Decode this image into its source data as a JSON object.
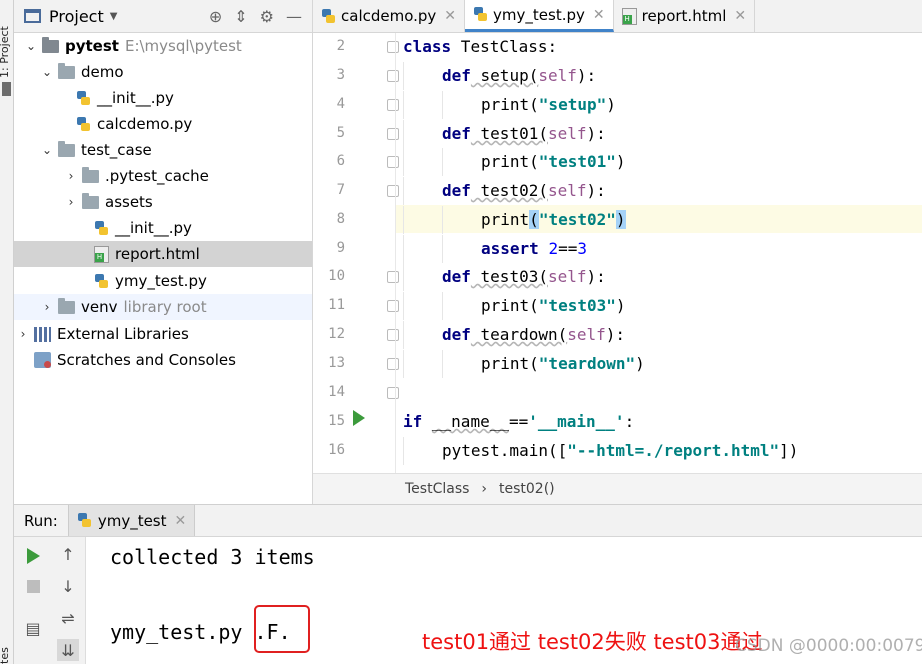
{
  "left_strip": {
    "project_label": "1: Project",
    "bottom_label": "tes"
  },
  "project_panel": {
    "title": "Project",
    "tree": [
      {
        "label": "pytest",
        "note": "E:\\mysql\\pytest"
      },
      {
        "label": "demo"
      },
      {
        "label": "__init__.py"
      },
      {
        "label": "calcdemo.py"
      },
      {
        "label": "test_case"
      },
      {
        "label": ".pytest_cache"
      },
      {
        "label": "assets"
      },
      {
        "label": "__init__.py"
      },
      {
        "label": "report.html"
      },
      {
        "label": "ymy_test.py"
      },
      {
        "label": "venv",
        "note": "library root"
      },
      {
        "label": "External Libraries"
      },
      {
        "label": "Scratches and Consoles"
      }
    ]
  },
  "editor": {
    "tabs": [
      {
        "label": "calcdemo.py"
      },
      {
        "label": "ymy_test.py"
      },
      {
        "label": "report.html"
      }
    ],
    "line_numbers": [
      "2",
      "3",
      "4",
      "5",
      "6",
      "7",
      "8",
      "9",
      "10",
      "11",
      "12",
      "13",
      "14",
      "15",
      "16"
    ],
    "code": {
      "l2_kw": "class",
      "l2_rest": " TestClass:",
      "l3_kw": "def",
      "l3_name": " setup(",
      "l3_self": "self",
      "l3_end": "):",
      "l4_fn": "print(",
      "l4_str": "\"setup\"",
      "l4_end": ")",
      "l5_kw": "def",
      "l5_name": " test01(",
      "l5_self": "self",
      "l5_end": "):",
      "l6_fn": "print(",
      "l6_str": "\"test01\"",
      "l6_end": ")",
      "l7_kw": "def",
      "l7_name": " test02(",
      "l7_self": "self",
      "l7_end": "):",
      "l8_fn": "print",
      "l8_open": "(",
      "l8_str": "\"test02\"",
      "l8_close": ")",
      "l9_kw": "assert",
      "l9_sp": " ",
      "l9_num1": "2",
      "l9_op": "==",
      "l9_num2": "3",
      "l10_kw": "def",
      "l10_name": " test03(",
      "l10_self": "self",
      "l10_end": "):",
      "l11_fn": "print(",
      "l11_str": "\"test03\"",
      "l11_end": ")",
      "l12_kw": "def",
      "l12_name": " teardown(",
      "l12_self": "self",
      "l12_end": "):",
      "l13_fn": "print(",
      "l13_str": "\"teardown\"",
      "l13_end": ")",
      "l15_kw": "if",
      "l15_sp": " ",
      "l15_name": "__name__",
      "l15_op": "==",
      "l15_str": "'__main__'",
      "l15_end": ":",
      "l16_fn": "pytest.main([",
      "l16_str": "\"--html=./report.html\"",
      "l16_end": "])"
    },
    "breadcrumb": {
      "class": "TestClass",
      "sep": "›",
      "method": "test02()"
    }
  },
  "run_panel": {
    "label": "Run:",
    "tab": "ymy_test",
    "console_line1": "collected 3 items",
    "console_line2_file": "ymy_test.py ",
    "console_line2_result": ".F."
  },
  "annotation": "test01通过 test02失败 test03通过",
  "watermark": "CSDN @0000:00:0079",
  "colors": {
    "accent": "#4083c9",
    "annotation": "#ee1111",
    "keyword": "#000080",
    "string": "#008080"
  }
}
